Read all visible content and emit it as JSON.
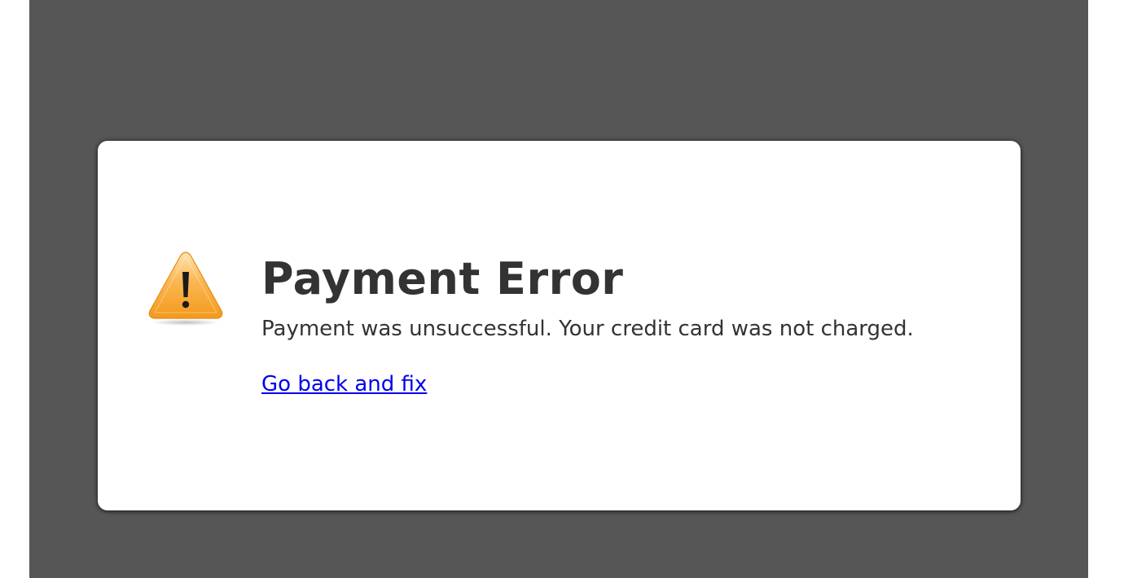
{
  "error": {
    "title": "Payment Error",
    "message": "Payment was unsuccessful. Your credit card was not charged.",
    "link_label": "Go back and fix",
    "icon": "warning-icon"
  },
  "colors": {
    "page_background": "#565656",
    "card_background": "#ffffff",
    "text": "#333333",
    "link": "#0000ee",
    "warning_orange": "#f7a12a"
  }
}
